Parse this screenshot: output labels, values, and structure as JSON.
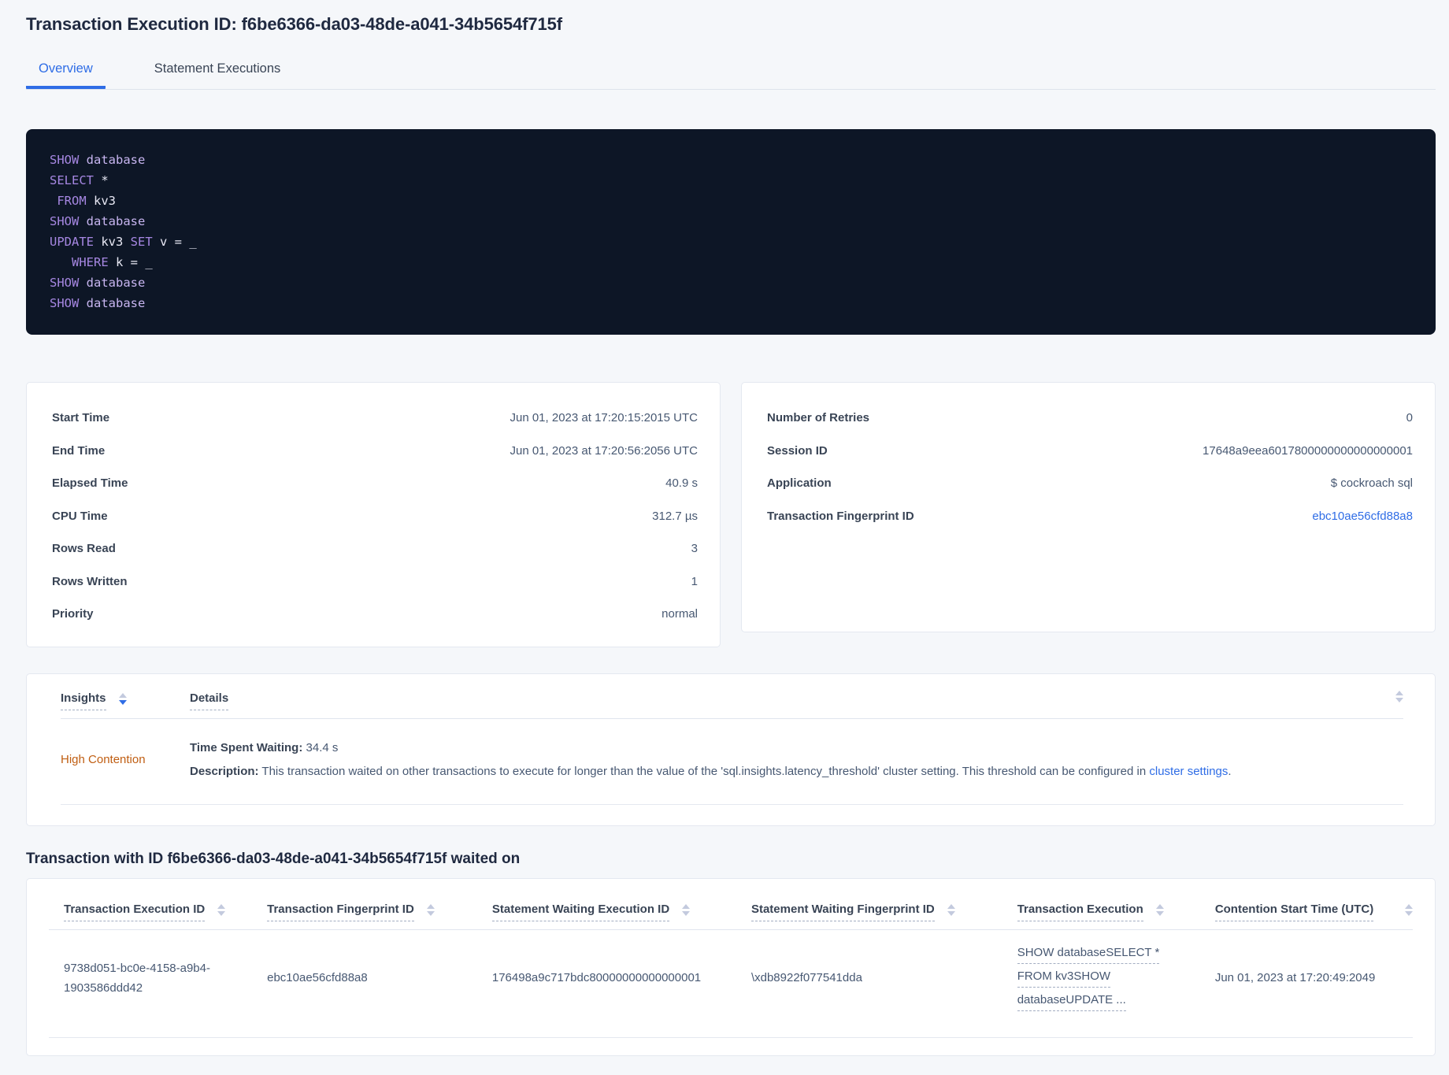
{
  "page": {
    "title": "Transaction Execution ID: f6be6366-da03-48de-a041-34b5654f715f",
    "tabs": [
      {
        "label": "Overview",
        "active": true
      },
      {
        "label": "Statement Executions",
        "active": false
      }
    ]
  },
  "colors": {
    "accent_blue": "#2f6de6",
    "warning_orange": "#c05e12",
    "code_background": "#0d1626",
    "code_keyword": "#a687e2",
    "code_secondary": "#c7b5f0",
    "code_plain": "#e8e8f4",
    "page_background": "#f5f7fa"
  },
  "code": {
    "lines": [
      [
        {
          "c": "kw",
          "t": "SHOW"
        },
        {
          "c": "pl",
          "t": " "
        },
        {
          "c": "db",
          "t": "database"
        }
      ],
      [
        {
          "c": "kw",
          "t": "SELECT"
        },
        {
          "c": "pl",
          "t": " *"
        }
      ],
      [
        {
          "c": "pl",
          "t": " "
        },
        {
          "c": "kw",
          "t": "FROM"
        },
        {
          "c": "pl",
          "t": " kv3"
        }
      ],
      [
        {
          "c": "kw",
          "t": "SHOW"
        },
        {
          "c": "pl",
          "t": " "
        },
        {
          "c": "db",
          "t": "database"
        }
      ],
      [
        {
          "c": "kw",
          "t": "UPDATE"
        },
        {
          "c": "pl",
          "t": " kv3 "
        },
        {
          "c": "kw",
          "t": "SET"
        },
        {
          "c": "pl",
          "t": " v = _"
        }
      ],
      [
        {
          "c": "pl",
          "t": "   "
        },
        {
          "c": "kw",
          "t": "WHERE"
        },
        {
          "c": "pl",
          "t": " k = _"
        }
      ],
      [
        {
          "c": "kw",
          "t": "SHOW"
        },
        {
          "c": "pl",
          "t": " "
        },
        {
          "c": "db",
          "t": "database"
        }
      ],
      [
        {
          "c": "kw",
          "t": "SHOW"
        },
        {
          "c": "pl",
          "t": " "
        },
        {
          "c": "db",
          "t": "database"
        }
      ]
    ]
  },
  "cards": {
    "left": {
      "rows": [
        {
          "label": "Start Time",
          "value": "Jun 01, 2023 at 17:20:15:2015 UTC"
        },
        {
          "label": "End Time",
          "value": "Jun 01, 2023 at 17:20:56:2056 UTC"
        },
        {
          "label": "Elapsed Time",
          "value": "40.9 s"
        },
        {
          "label": "CPU Time",
          "value": "312.7 µs"
        },
        {
          "label": "Rows Read",
          "value": "3"
        },
        {
          "label": "Rows Written",
          "value": "1"
        },
        {
          "label": "Priority",
          "value": "normal"
        }
      ]
    },
    "right": {
      "rows": [
        {
          "label": "Number of Retries",
          "value": "0"
        },
        {
          "label": "Session ID",
          "value": "17648a9eea6017800000000000000001"
        },
        {
          "label": "Application",
          "value": "$ cockroach sql"
        },
        {
          "label": "Transaction Fingerprint ID",
          "value": "ebc10ae56cfd88a8",
          "link": true
        }
      ]
    }
  },
  "insights": {
    "columns": [
      {
        "label": "Insights",
        "sort": "desc"
      },
      {
        "label": "Details",
        "sort": null
      }
    ],
    "row": {
      "insight": "High Contention",
      "waiting_label": "Time Spent Waiting:",
      "waiting_value": " 34.4 s",
      "description_label": "Description:",
      "description_text": " This transaction waited on other transactions to execute for longer than the value of the 'sql.insights.latency_threshold' cluster setting. This threshold can be configured in ",
      "description_link": "cluster settings",
      "description_suffix": "."
    }
  },
  "waited_section": {
    "title": "Transaction with ID f6be6366-da03-48de-a041-34b5654f715f waited on",
    "columns": [
      "Transaction Execution ID",
      "Transaction Fingerprint ID",
      "Statement Waiting Execution ID",
      "Statement Waiting Fingerprint ID",
      "Transaction Execution",
      "Contention Start Time (UTC)"
    ],
    "rows": [
      {
        "transaction_execution_id": "9738d051-bc0e-4158-a9b4-1903586ddd42",
        "transaction_fingerprint_id": "ebc10ae56cfd88a8",
        "statement_waiting_execution_id": "176498a9c717bdc80000000000000001",
        "statement_waiting_fingerprint_id": "\\xdb8922f077541dda",
        "transaction_execution_lines": [
          "SHOW databaseSELECT *",
          "FROM kv3SHOW",
          "databaseUPDATE ..."
        ],
        "contention_start_time": "Jun 01, 2023 at 17:20:49:2049"
      }
    ]
  }
}
